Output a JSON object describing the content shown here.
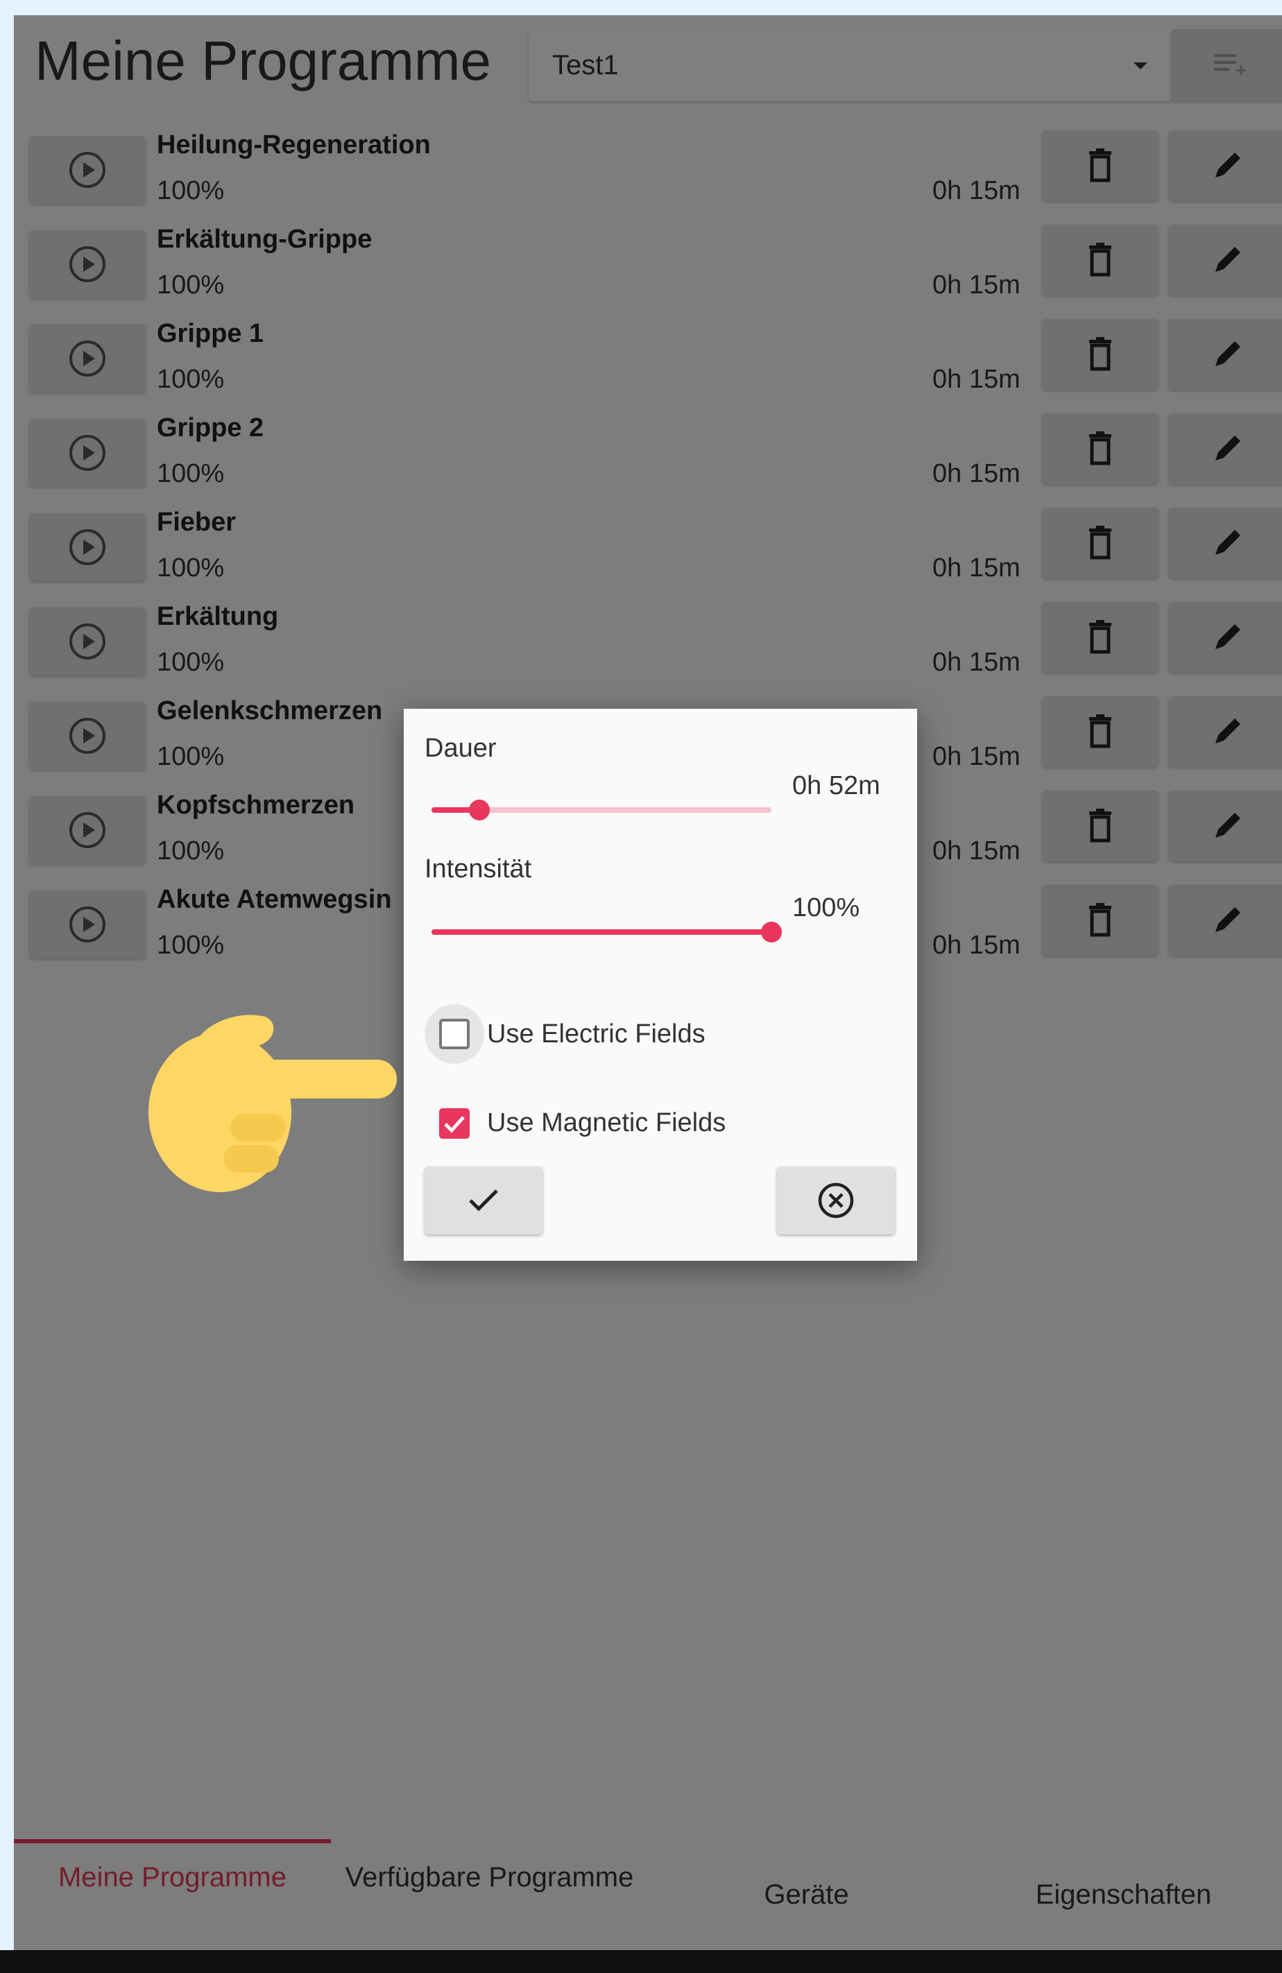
{
  "header": {
    "title": "Meine Programme",
    "profile_select": {
      "value": "Test1",
      "icon": "chevron-down-icon"
    },
    "queue_icon": "playlist-add-icon"
  },
  "programs": [
    {
      "name": "Heilung-Regeneration",
      "intensity": "100%",
      "duration": "0h 15m"
    },
    {
      "name": "Erkältung-Grippe",
      "intensity": "100%",
      "duration": "0h 15m"
    },
    {
      "name": "Grippe 1",
      "intensity": "100%",
      "duration": "0h 15m"
    },
    {
      "name": "Grippe 2",
      "intensity": "100%",
      "duration": "0h 15m"
    },
    {
      "name": "Fieber",
      "intensity": "100%",
      "duration": "0h 15m"
    },
    {
      "name": "Erkältung",
      "intensity": "100%",
      "duration": "0h 15m"
    },
    {
      "name": "Gelenkschmerzen",
      "intensity": "100%",
      "duration": "0h 15m"
    },
    {
      "name": "Kopfschmerzen",
      "intensity": "100%",
      "duration": "0h 15m"
    },
    {
      "name": "Akute Atemwegsin",
      "intensity": "100%",
      "duration": "0h 15m"
    }
  ],
  "row_icons": {
    "play": "play-circle-icon",
    "delete": "trash-icon",
    "edit": "pencil-icon"
  },
  "dialog": {
    "duration_label": "Dauer",
    "duration_value": "0h 52m",
    "duration_fraction": 0.14,
    "intensity_label": "Intensität",
    "intensity_value": "100%",
    "intensity_fraction": 1.0,
    "electric_label": "Use Electric Fields",
    "electric_checked": false,
    "magnetic_label": "Use Magnetic Fields",
    "magnetic_checked": true,
    "confirm_icon": "checkmark-icon",
    "cancel_icon": "close-circle-icon"
  },
  "annotation": {
    "icon": "pointing-hand-icon"
  },
  "tabs": [
    {
      "label": "Meine Programme",
      "active": true
    },
    {
      "label": "Verfügbare Programme",
      "active": false
    },
    {
      "label": "Geräte",
      "active": false
    },
    {
      "label": "Eigenschaften",
      "active": false
    }
  ],
  "colors": {
    "accent": "#e8365d",
    "accent_light": "#f6c3cf",
    "hand": "#fdd663"
  }
}
